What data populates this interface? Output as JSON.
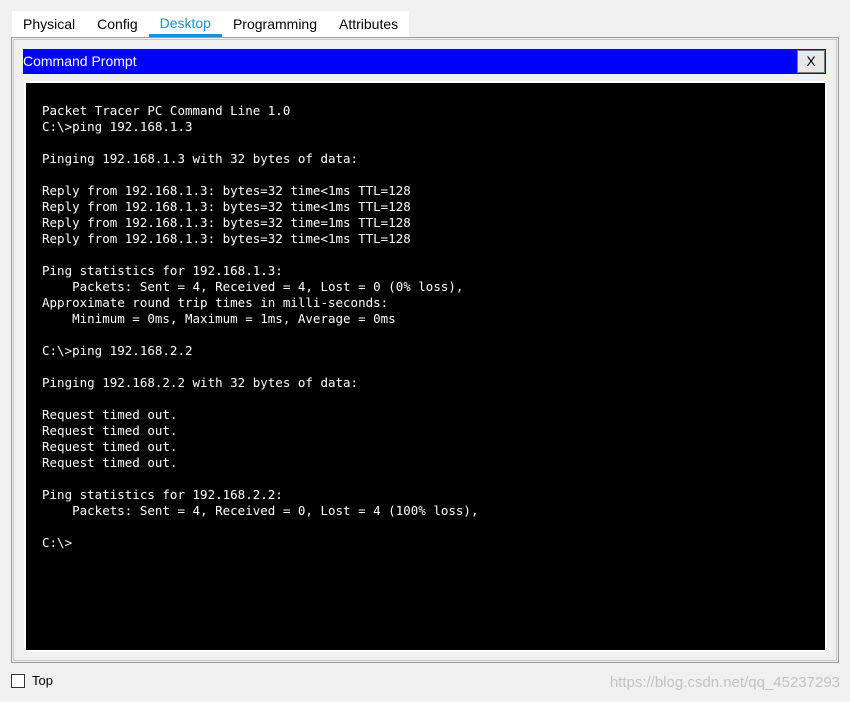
{
  "tabs": [
    {
      "label": "Physical",
      "active": false
    },
    {
      "label": "Config",
      "active": false
    },
    {
      "label": "Desktop",
      "active": true
    },
    {
      "label": "Programming",
      "active": false
    },
    {
      "label": "Attributes",
      "active": false
    }
  ],
  "window": {
    "title": "Command Prompt",
    "close_label": "X"
  },
  "terminal": {
    "output": "Packet Tracer PC Command Line 1.0\nC:\\>ping 192.168.1.3\n\nPinging 192.168.1.3 with 32 bytes of data:\n\nReply from 192.168.1.3: bytes=32 time<1ms TTL=128\nReply from 192.168.1.3: bytes=32 time<1ms TTL=128\nReply from 192.168.1.3: bytes=32 time=1ms TTL=128\nReply from 192.168.1.3: bytes=32 time<1ms TTL=128\n\nPing statistics for 192.168.1.3:\n    Packets: Sent = 4, Received = 4, Lost = 0 (0% loss),\nApproximate round trip times in milli-seconds:\n    Minimum = 0ms, Maximum = 1ms, Average = 0ms\n\nC:\\>ping 192.168.2.2\n\nPinging 192.168.2.2 with 32 bytes of data:\n\nRequest timed out.\nRequest timed out.\nRequest timed out.\nRequest timed out.\n\nPing statistics for 192.168.2.2:\n    Packets: Sent = 4, Received = 0, Lost = 4 (100% loss),\n\nC:\\>"
  },
  "footer": {
    "top_label": "Top",
    "top_checked": false,
    "watermark": "https://blog.csdn.net/qq_45237293"
  },
  "colors": {
    "titlebar": "#0000ff",
    "active_tab": "#1e90d8",
    "terminal_bg": "#000000",
    "terminal_fg": "#ffffff"
  }
}
